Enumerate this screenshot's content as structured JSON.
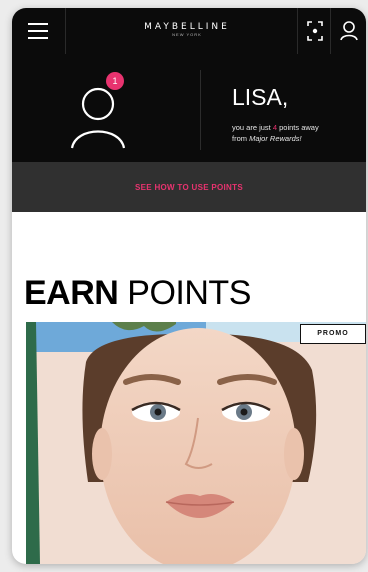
{
  "header": {
    "brand": "MAYBELLINE",
    "brand_sub": "NEW YORK",
    "icons": [
      "menu-icon",
      "scan-icon",
      "user-icon"
    ]
  },
  "profile": {
    "notification_count": "1",
    "greeting": "LISA,",
    "points_prefix": "you are just ",
    "points_value": "4",
    "points_suffix": " points away",
    "rewards_prefix": "from ",
    "rewards_name": "Major Rewards!"
  },
  "cta": {
    "label": "SEE HOW TO USE POINTS"
  },
  "earn": {
    "title_bold": "EARN",
    "title_light": "POINTS"
  },
  "promo": {
    "badge": "PROMO"
  },
  "colors": {
    "accent": "#e8336f",
    "header_bg": "#0b0b0b",
    "cta_bg": "#303030"
  }
}
